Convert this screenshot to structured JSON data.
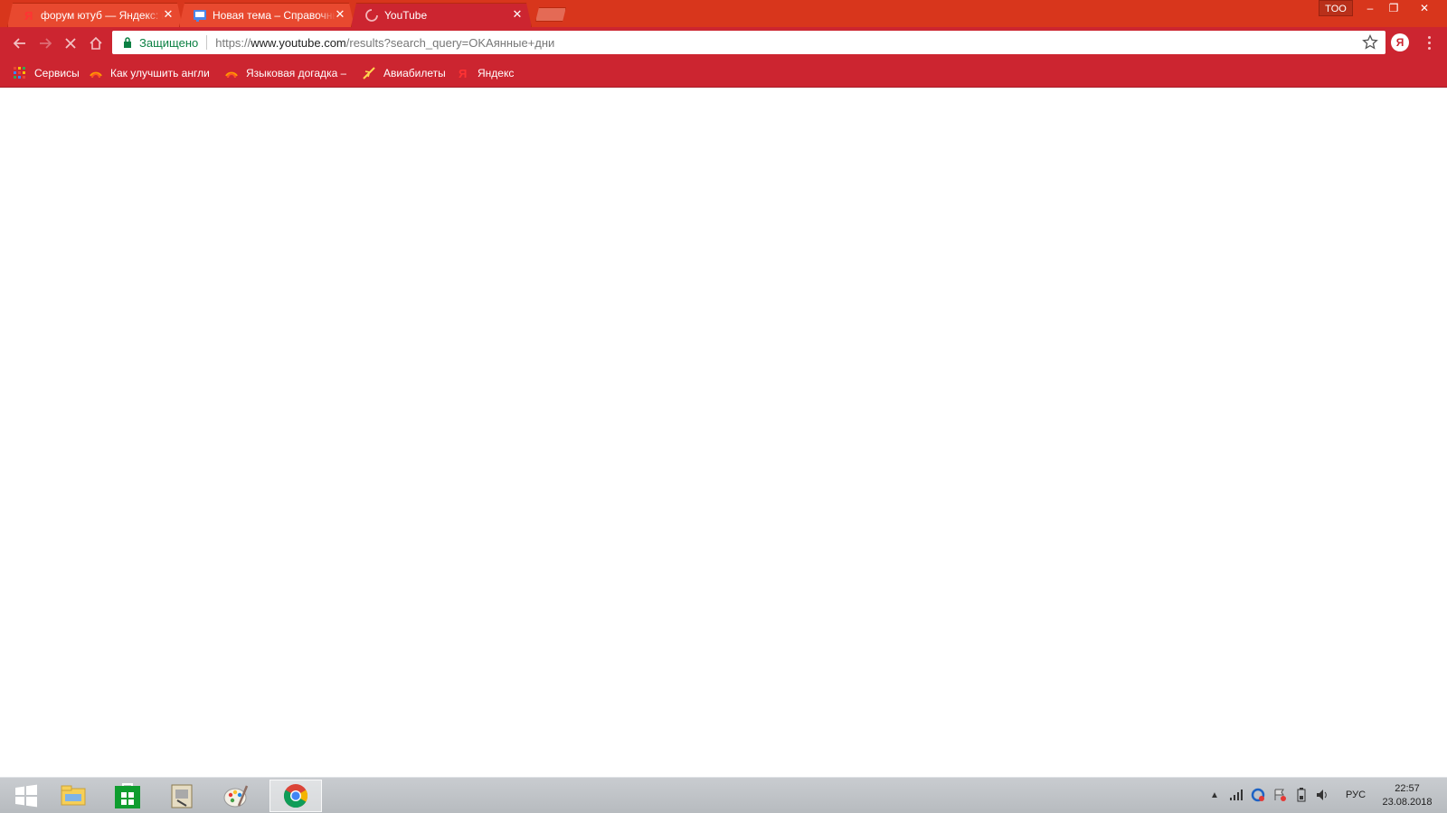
{
  "tabs": [
    {
      "title": "форум ютуб — Яндекс: нашлось",
      "favicon": "yandex-icon",
      "close": "✕"
    },
    {
      "title": "Новая тема – Справочный форум",
      "favicon": "help-forum-icon",
      "close": "✕"
    },
    {
      "title": "YouTube",
      "favicon": "loading-spinner-icon",
      "close": "✕",
      "active": true
    }
  ],
  "window": {
    "profile_label": "TOO",
    "minimize": "–",
    "restore": "❐",
    "close": "✕"
  },
  "toolbar": {
    "secure_label": "Защищено",
    "url_scheme": "https://",
    "url_host": "www.youtube.com",
    "url_path": "/results?search_query=OKAянные+дни",
    "yandex_ext_label": "Я"
  },
  "bookmarks": [
    {
      "label": "Сервисы",
      "icon": "apps-grid-icon"
    },
    {
      "label": "Как улучшить англи",
      "icon": "rss-icon"
    },
    {
      "label": "Языковая догадка –",
      "icon": "rss-icon"
    },
    {
      "label": "Авиабилеты",
      "icon": "plane-icon"
    },
    {
      "label": "Яндекс",
      "icon": "yandex-icon"
    }
  ],
  "taskbar": {
    "apps": [
      "windows-start-icon",
      "file-explorer-icon",
      "store-icon",
      "archive-icon",
      "paint-icon",
      "chrome-icon"
    ],
    "language": "РУС",
    "time": "22:57",
    "date": "23.08.2018"
  },
  "colors": {
    "tabstrip": "#d8361c",
    "toolbar": "#cc2530",
    "secure": "#0b8043"
  }
}
